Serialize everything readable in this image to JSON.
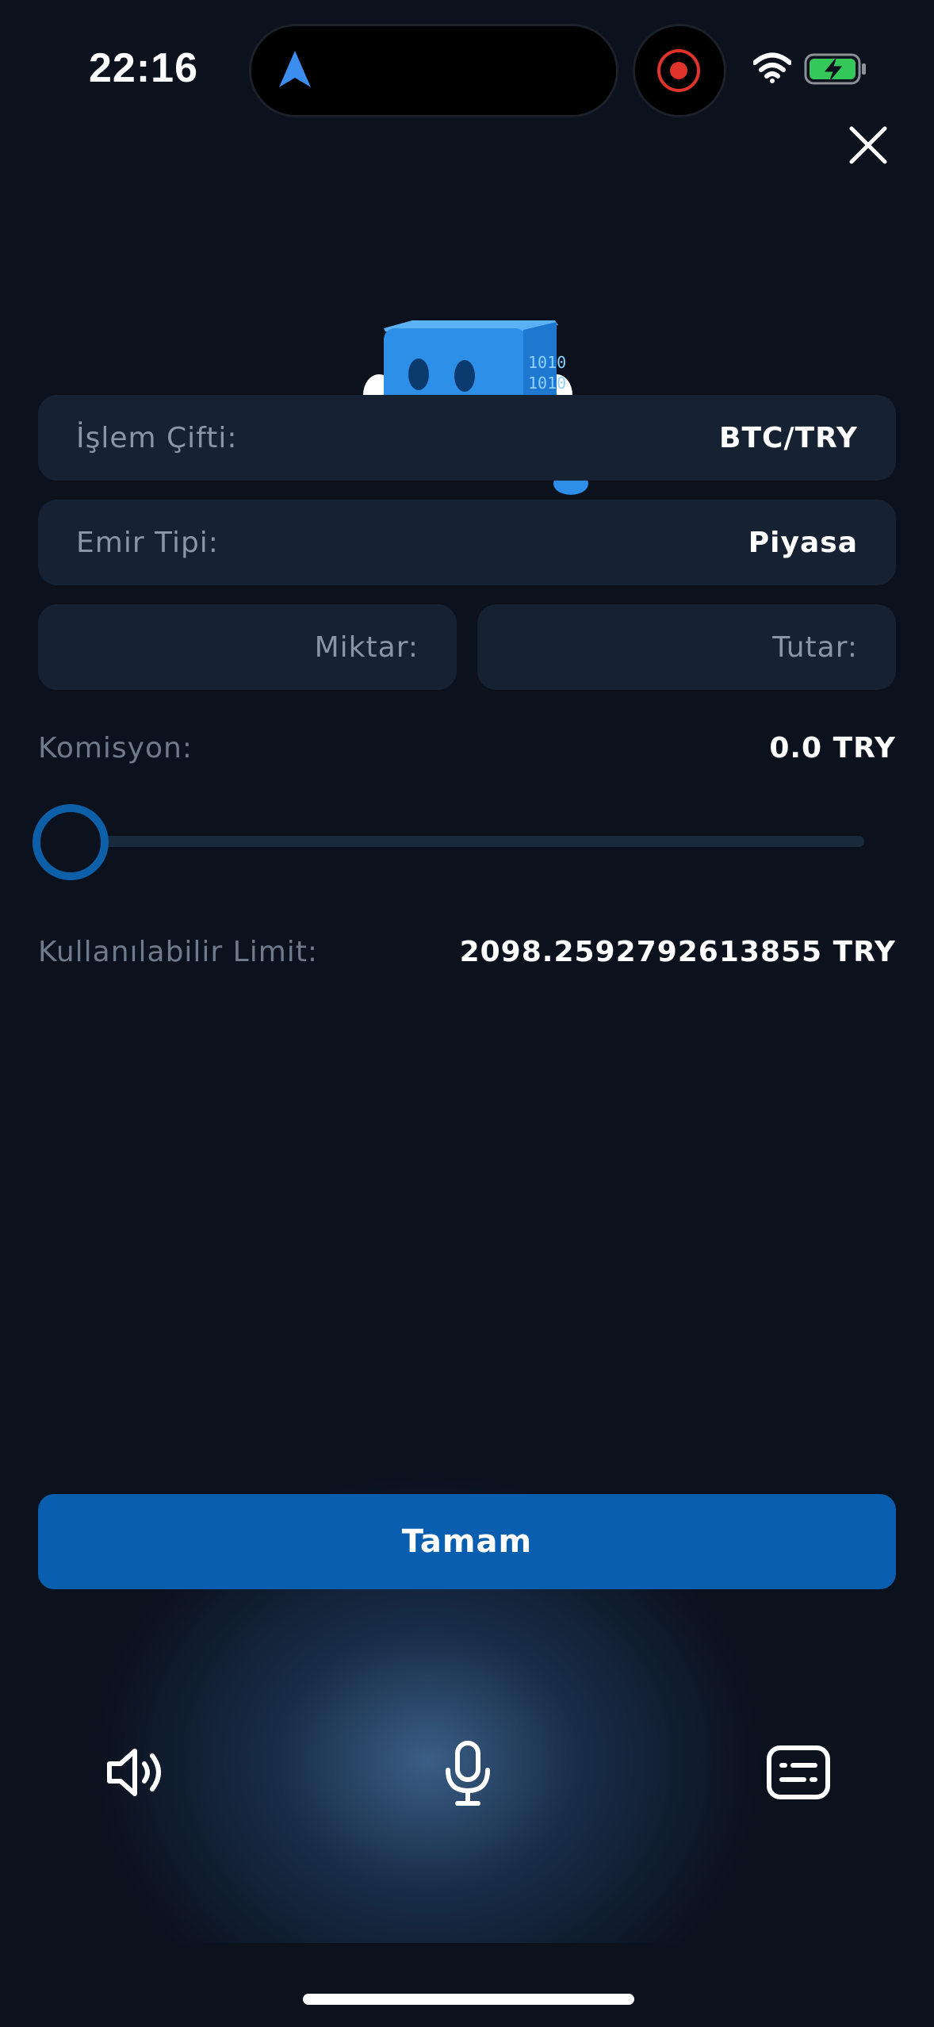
{
  "status_bar": {
    "time": "22:16"
  },
  "icons": {
    "close": "close-icon",
    "speaker": "speaker-icon",
    "microphone": "microphone-icon",
    "keyboard": "keyboard-icon",
    "navigation": "location-arrow-icon",
    "record": "record-icon",
    "wifi": "wifi-icon",
    "battery": "battery-charging-icon"
  },
  "form": {
    "pair_label": "İşlem Çifti:",
    "pair_value": "BTC/TRY",
    "order_type_label": "Emir Tipi:",
    "order_type_value": "Piyasa",
    "amount_label": "Miktar:",
    "total_label": "Tutar:",
    "commission_label": "Komisyon:",
    "commission_value": "0.0 TRY",
    "slider_value_percent": 0,
    "limit_label": "Kullanılabilir Limit:",
    "limit_value": "2098.2592792613855 TRY"
  },
  "actions": {
    "ok_label": "Tamam"
  },
  "colors": {
    "background": "#0b111d",
    "card": "#162131",
    "accent": "#0a5eb0",
    "label": "#8a95a6",
    "mascot": "#2e8fe8"
  }
}
